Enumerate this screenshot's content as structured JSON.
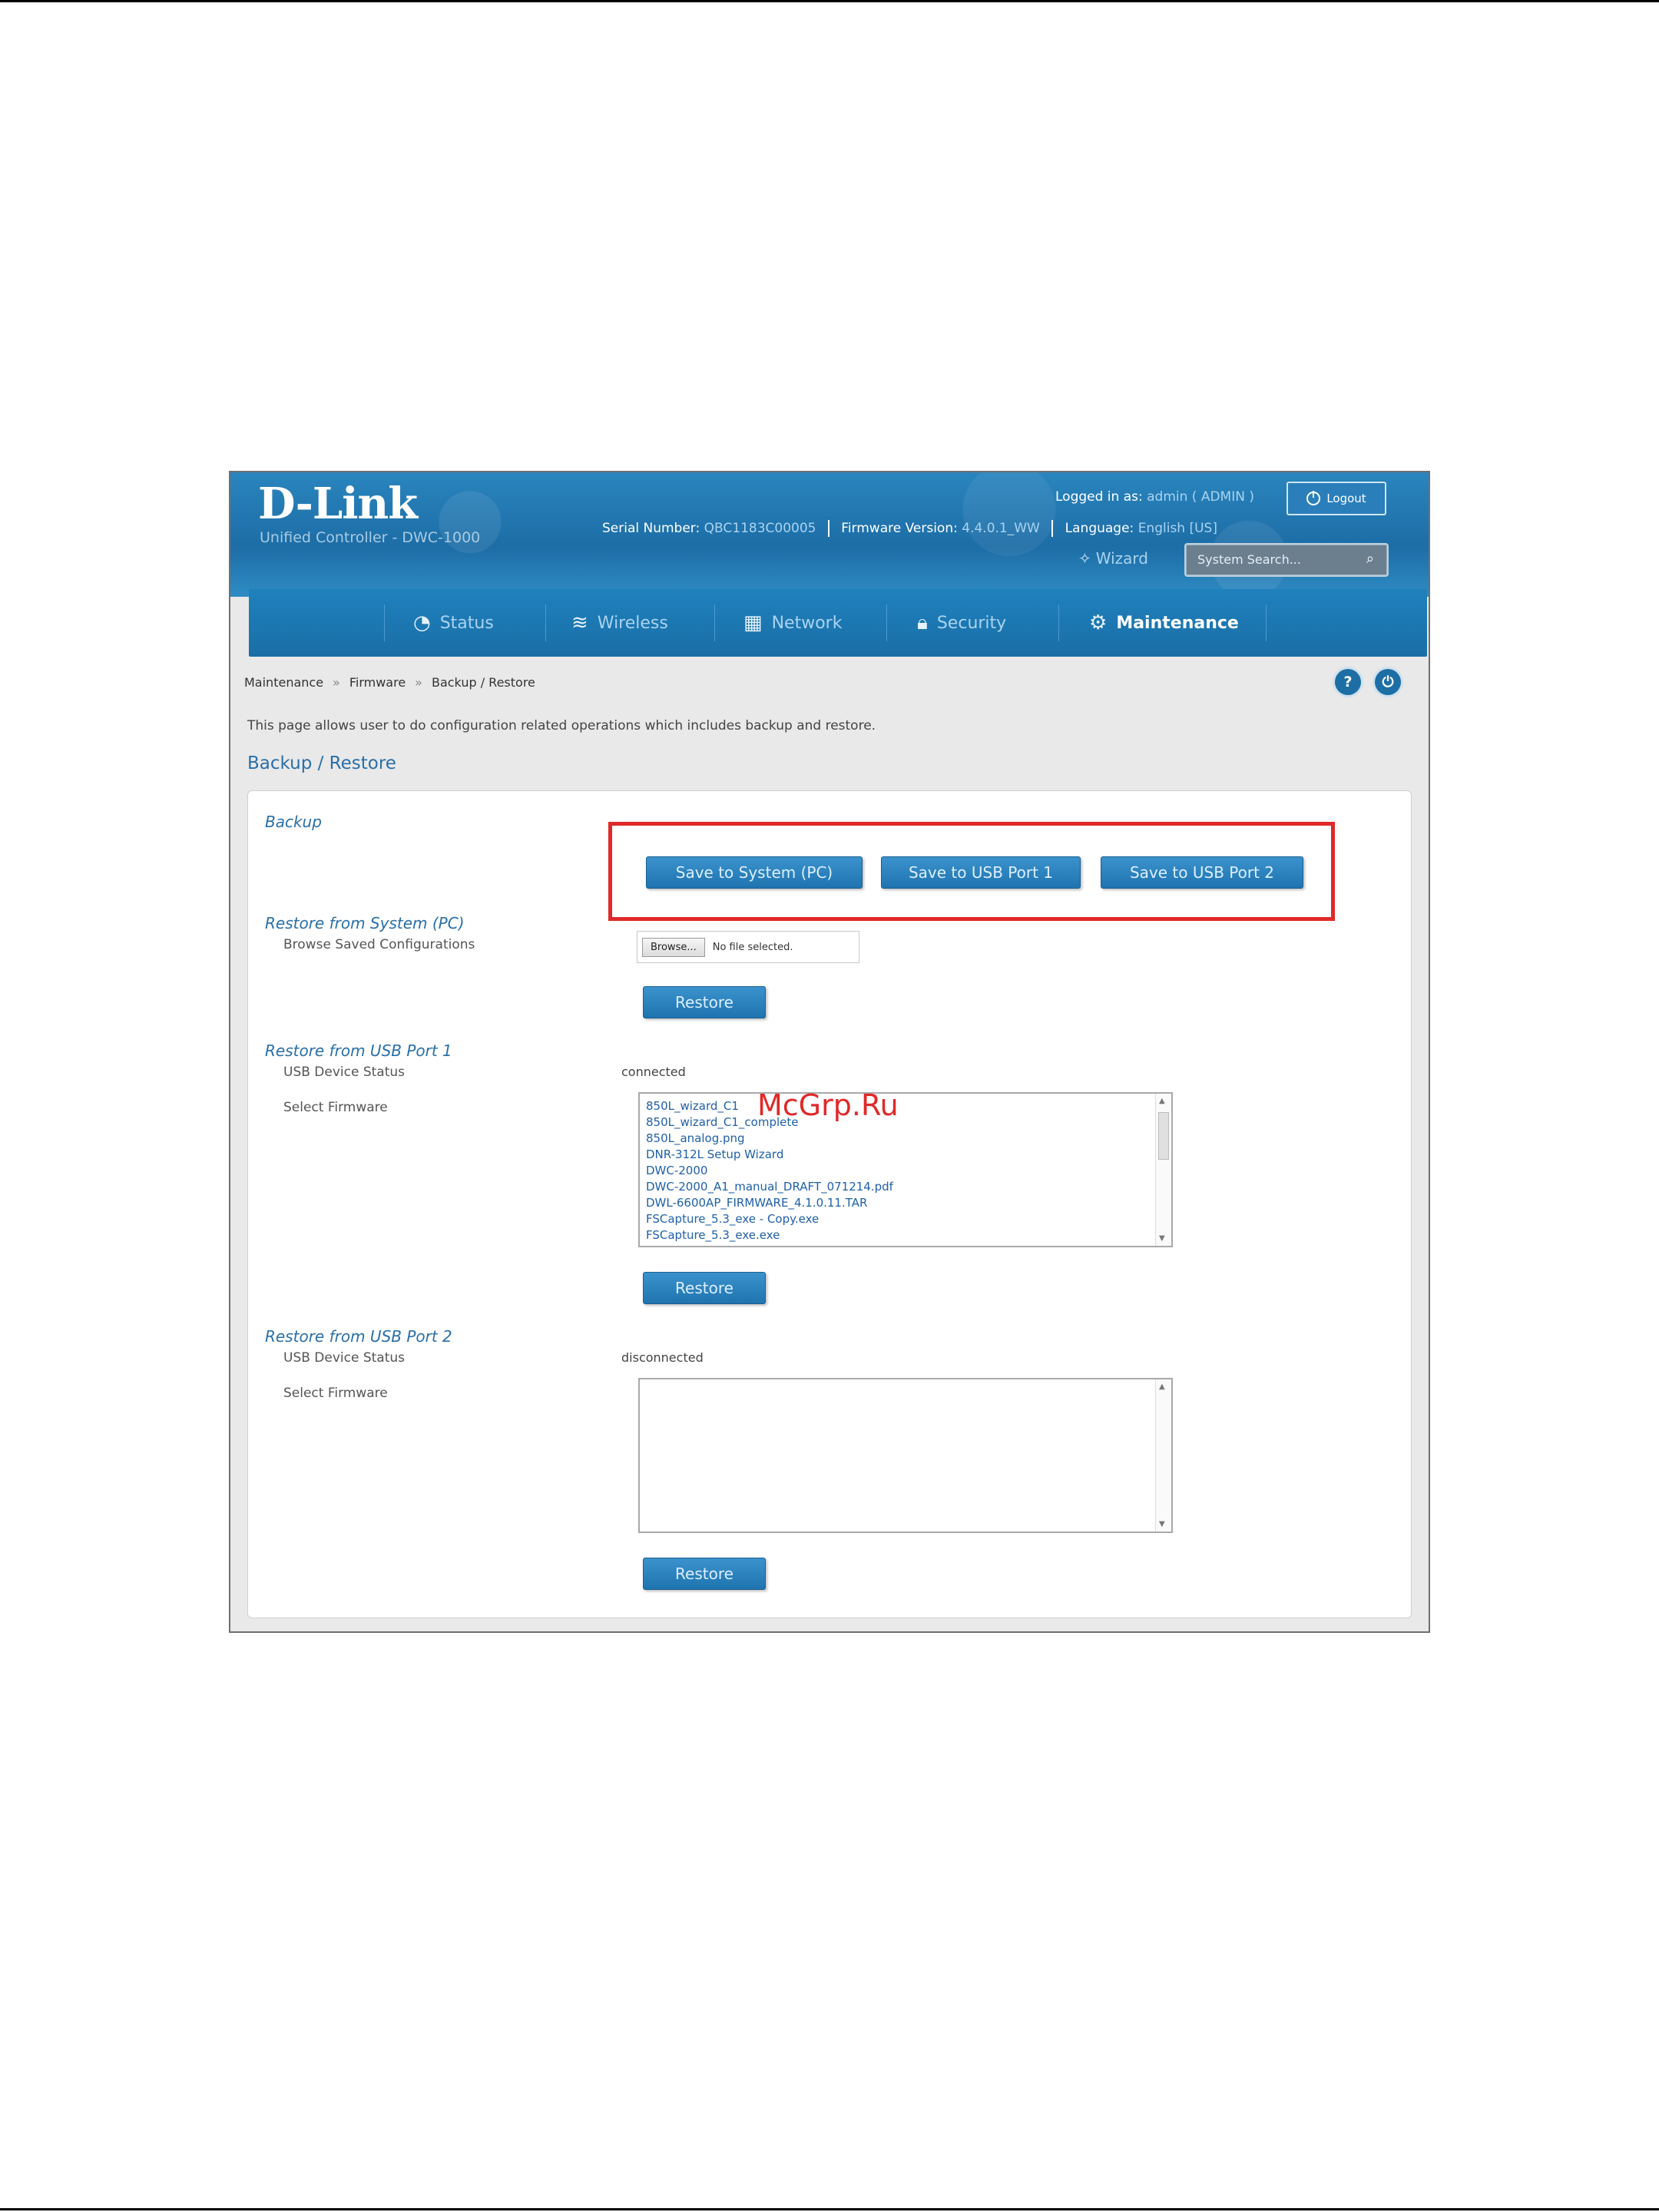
{
  "header": {
    "logo": "D-Link",
    "logo_sub": "Unified Controller - DWC-1000",
    "serial_label": "Serial Number:",
    "serial_value": "QBC1183C00005",
    "firmware_label": "Firmware Version:",
    "firmware_value": "4.4.0.1_WW",
    "logged_in_label": "Logged in as:",
    "logged_in_value": "admin ( ADMIN )",
    "logout": "Logout",
    "language_label": "Language:",
    "language_value": "English [US]",
    "wizard": "Wizard",
    "search_placeholder": "System Search..."
  },
  "nav": [
    {
      "label": "Status",
      "icon": "gauge-icon"
    },
    {
      "label": "Wireless",
      "icon": "wifi-icon"
    },
    {
      "label": "Network",
      "icon": "network-icon"
    },
    {
      "label": "Security",
      "icon": "lock-icon"
    },
    {
      "label": "Maintenance",
      "icon": "gear-icon",
      "active": true
    }
  ],
  "breadcrumb": [
    "Maintenance",
    "Firmware",
    "Backup / Restore"
  ],
  "intro": "This page allows user to do configuration related operations which includes backup and restore.",
  "section_title": "Backup / Restore",
  "backup": {
    "title": "Backup",
    "buttons": [
      "Save to System (PC)",
      "Save to USB Port 1",
      "Save to USB Port 2"
    ]
  },
  "restore_pc": {
    "title": "Restore from System (PC)",
    "label": "Browse Saved Configurations",
    "browse": "Browse...",
    "no_file": "No file selected.",
    "button": "Restore"
  },
  "restore_usb1": {
    "title": "Restore from USB Port 1",
    "status_label": "USB Device Status",
    "status_value": "connected",
    "select_label": "Select Firmware",
    "files": [
      "850L_wizard_C1",
      "850L_wizard_C1_complete",
      "850L_analog.png",
      "DNR-312L Setup Wizard",
      "DWC-2000",
      "DWC-2000_A1_manual_DRAFT_071214.pdf",
      "DWL-6600AP_FIRMWARE_4.1.0.11.TAR",
      "FSCapture_5.3_exe - Copy.exe",
      "FSCapture_5.3_exe.exe"
    ],
    "button": "Restore"
  },
  "restore_usb2": {
    "title": "Restore from USB Port 2",
    "status_label": "USB Device Status",
    "status_value": "disconnected",
    "select_label": "Select Firmware",
    "button": "Restore"
  },
  "watermark": "McGrp.Ru",
  "colors": {
    "highlight": "#e02929",
    "brand_blue": "#1f74b0",
    "link": "#2a6fa8"
  }
}
